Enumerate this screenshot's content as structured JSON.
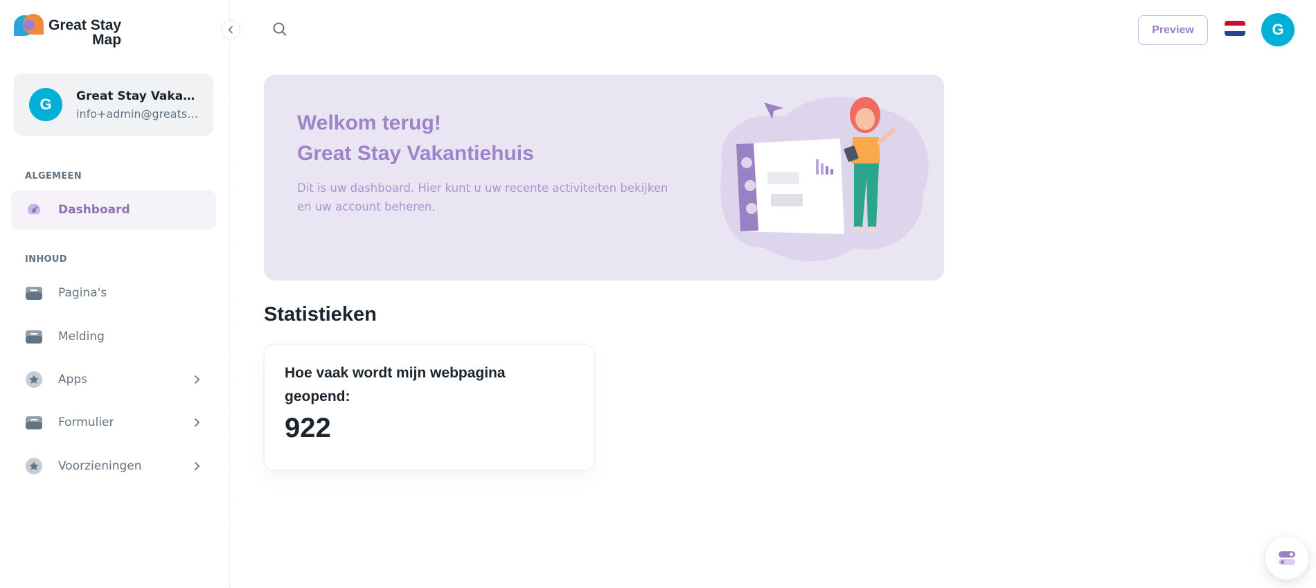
{
  "app": {
    "logo_line1": "Great Stay",
    "logo_line2": "Map"
  },
  "account": {
    "avatar_letter": "G",
    "name": "Great Stay Vakantiehuis",
    "email": "info+admin@greatstaymap.com"
  },
  "sidebar": {
    "sections": [
      {
        "label": "ALGEMEEN"
      },
      {
        "label": "INHOUD"
      }
    ],
    "items": [
      {
        "label": "Dashboard",
        "icon": "dashboard-icon",
        "active": true
      },
      {
        "label": "Pagina's",
        "icon": "inbox-icon"
      },
      {
        "label": "Melding",
        "icon": "inbox-icon"
      },
      {
        "label": "Apps",
        "icon": "star-icon",
        "has_submenu": true
      },
      {
        "label": "Formulier",
        "icon": "inbox-icon",
        "has_submenu": true
      },
      {
        "label": "Voorzieningen",
        "icon": "star-icon",
        "has_submenu": true
      }
    ]
  },
  "header": {
    "preview_label": "Preview",
    "language": "nl-flag-icon",
    "avatar_letter": "G"
  },
  "welcome": {
    "title_line1": "Welkom terug!",
    "title_line2": "Great Stay Vakantiehuis",
    "description": "Dit is uw dashboard. Hier kunt u uw recente activiteiten bekijken en uw account beheren."
  },
  "stats": {
    "title": "Statistieken",
    "cards": [
      {
        "label": "Hoe vaak wordt mijn webpagina geopend:",
        "value": "922"
      }
    ]
  },
  "colors": {
    "accent": "#9e83c8",
    "avatar": "#00b0d6",
    "banner_bg": "#e9e5f2"
  }
}
